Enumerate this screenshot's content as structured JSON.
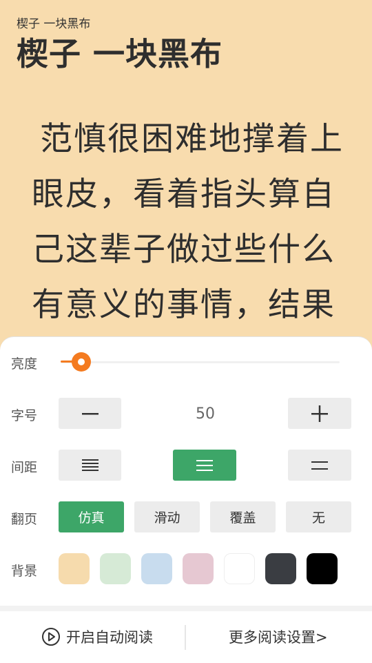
{
  "chapter": {
    "small_title": "楔子 一块黑布",
    "title": "楔子 一块黑布"
  },
  "content": {
    "text": "范慎很困难地撑着上眼皮，看着指头算自己这辈子做过些什么有意义的事情，结果"
  },
  "settings": {
    "brightness": {
      "label": "亮度",
      "level": 0.07
    },
    "font_size": {
      "label": "字号",
      "value": "50",
      "decrease_icon": "minus-icon",
      "increase_icon": "plus-icon"
    },
    "spacing": {
      "label": "间距",
      "options": [
        "tight-spacing-icon",
        "medium-spacing-icon",
        "wide-spacing-icon"
      ],
      "selected": 1
    },
    "page_turn": {
      "label": "翻页",
      "options": [
        "仿真",
        "滑动",
        "覆盖",
        "无"
      ],
      "selected": 0
    },
    "background": {
      "label": "背景",
      "colors": [
        "#f6dbad",
        "#d6ead6",
        "#c8dcee",
        "#e6c8d2",
        "#ffffff",
        "#3a3d42",
        "#000000"
      ]
    }
  },
  "bottom": {
    "auto_read": "开启自动阅读",
    "more_settings": "更多阅读设置>"
  },
  "colors": {
    "accent_green": "#3da668",
    "slider_orange": "#f47b20",
    "reader_background": "#f8dcae"
  }
}
